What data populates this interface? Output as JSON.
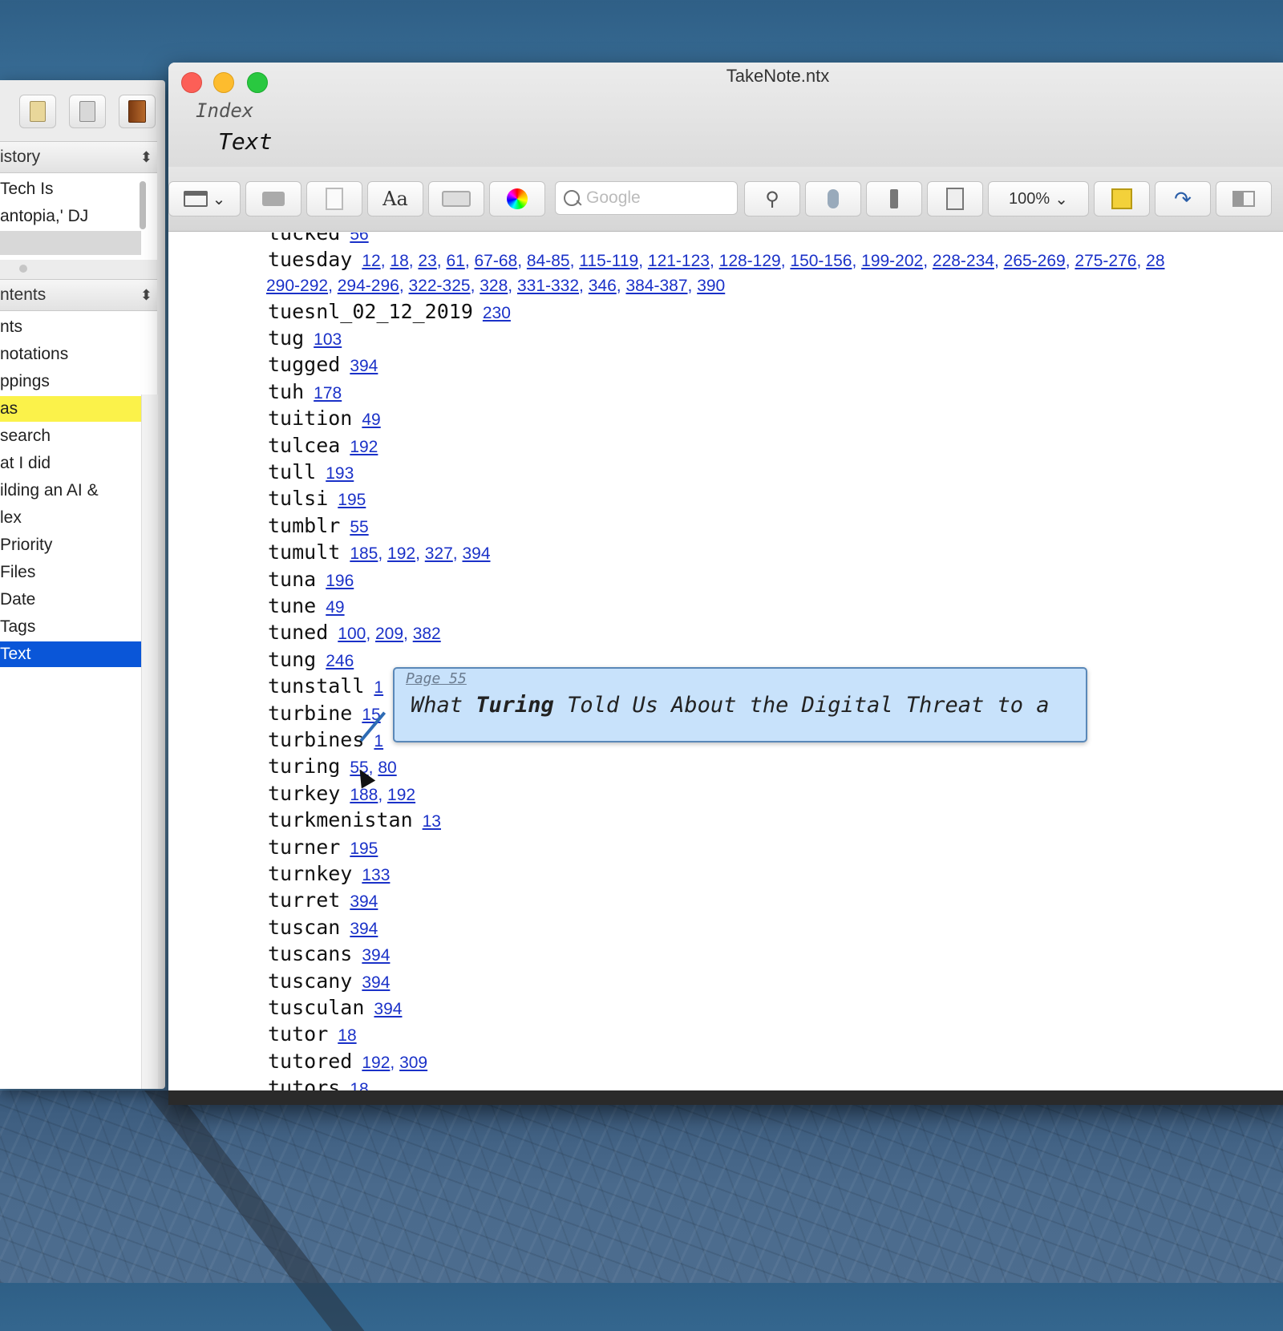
{
  "window": {
    "title": "TakeNote.ntx",
    "breadcrumb_index": "Index",
    "breadcrumb_text": "Text"
  },
  "toolbar": {
    "search_placeholder": "Google",
    "zoom": "100%",
    "font_label": "Aa",
    "icons": [
      "layout-icon",
      "print-icon",
      "page-icon",
      "font-icon",
      "keyboard-icon",
      "color-wheel-icon",
      "search-icon",
      "pin-icon",
      "microphone-icon",
      "flashlight-icon",
      "note-icon",
      "zoom-select",
      "highlight-icon",
      "share-icon",
      "columns-icon"
    ]
  },
  "sidebar": {
    "history_header": "istory",
    "history_items": [
      "Tech Is",
      "antopia,' DJ"
    ],
    "contents_header": "ntents",
    "contents_items": [
      {
        "label": "nts",
        "state": "normal"
      },
      {
        "label": "notations",
        "state": "normal"
      },
      {
        "label": "ppings",
        "state": "normal"
      },
      {
        "label": "as",
        "state": "highlighted"
      },
      {
        "label": "search",
        "state": "normal"
      },
      {
        "label": "at I did",
        "state": "normal"
      },
      {
        "label": "ilding an AI &",
        "state": "normal"
      },
      {
        "label": "lex",
        "state": "normal"
      },
      {
        "label": "Priority",
        "state": "normal"
      },
      {
        "label": "Files",
        "state": "normal"
      },
      {
        "label": "Date",
        "state": "normal"
      },
      {
        "label": "Tags",
        "state": "normal"
      },
      {
        "label": "Text",
        "state": "selected"
      }
    ]
  },
  "index_entries": [
    {
      "word": "tucked",
      "pages": [
        "56"
      ]
    },
    {
      "word": "tuesday",
      "pages": [
        "12",
        "18",
        "23",
        "61",
        "67-68",
        "84-85",
        "115-119",
        "121-123",
        "128-129",
        "150-156",
        "199-202",
        "228-234",
        "265-269",
        "275-276",
        "28"
      ],
      "pages2": [
        "290-292",
        "294-296",
        "322-325",
        "328",
        "331-332",
        "346",
        "384-387",
        "390"
      ]
    },
    {
      "word": "tuesnl_02_12_2019",
      "pages": [
        "230"
      ]
    },
    {
      "word": "tug",
      "pages": [
        "103"
      ]
    },
    {
      "word": "tugged",
      "pages": [
        "394"
      ]
    },
    {
      "word": "tuh",
      "pages": [
        "178"
      ]
    },
    {
      "word": "tuition",
      "pages": [
        "49"
      ]
    },
    {
      "word": "tulcea",
      "pages": [
        "192"
      ]
    },
    {
      "word": "tull",
      "pages": [
        "193"
      ]
    },
    {
      "word": "tulsi",
      "pages": [
        "195"
      ]
    },
    {
      "word": "tumblr",
      "pages": [
        "55"
      ]
    },
    {
      "word": "tumult",
      "pages": [
        "185",
        "192",
        "327",
        "394"
      ]
    },
    {
      "word": "tuna",
      "pages": [
        "196"
      ]
    },
    {
      "word": "tune",
      "pages": [
        "49"
      ]
    },
    {
      "word": "tuned",
      "pages": [
        "100",
        "209",
        "382"
      ]
    },
    {
      "word": "tung",
      "pages": [
        "246"
      ]
    },
    {
      "word": "tunstall",
      "pages": [
        "1"
      ]
    },
    {
      "word": "turbine",
      "pages": [
        "15"
      ]
    },
    {
      "word": "turbines",
      "pages": [
        "1"
      ]
    },
    {
      "word": "turing",
      "pages": [
        "55",
        "80"
      ]
    },
    {
      "word": "turkey",
      "pages": [
        "188",
        "192"
      ]
    },
    {
      "word": "turkmenistan",
      "pages": [
        "13"
      ]
    },
    {
      "word": "turner",
      "pages": [
        "195"
      ]
    },
    {
      "word": "turnkey",
      "pages": [
        "133"
      ]
    },
    {
      "word": "turret",
      "pages": [
        "394"
      ]
    },
    {
      "word": "tuscan",
      "pages": [
        "394"
      ]
    },
    {
      "word": "tuscans",
      "pages": [
        "394"
      ]
    },
    {
      "word": "tuscany",
      "pages": [
        "394"
      ]
    },
    {
      "word": "tusculan",
      "pages": [
        "394"
      ]
    },
    {
      "word": "tutor",
      "pages": [
        "18"
      ]
    },
    {
      "word": "tutored",
      "pages": [
        "192",
        "309"
      ]
    },
    {
      "word": "tutors",
      "pages": [
        "18"
      ]
    }
  ],
  "tooltip": {
    "page": "Page 55",
    "text_before": "What ",
    "text_bold": "Turing",
    "text_after": " Told Us About the Digital Threat to a"
  },
  "colors": {
    "link": "#1a31c8",
    "selected": "#0a56d8",
    "highlight": "#fbf24a",
    "tooltip_bg": "#c8e2fb"
  }
}
